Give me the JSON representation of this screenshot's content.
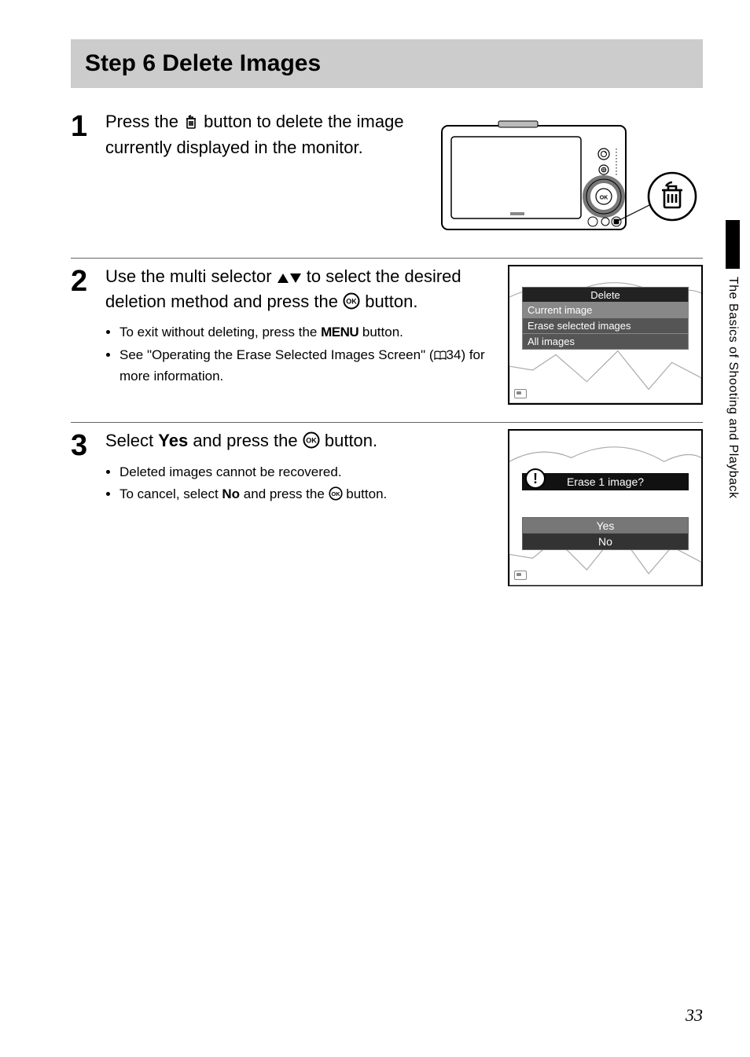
{
  "title": "Step 6 Delete Images",
  "sidebar_text": "The Basics of Shooting and Playback",
  "page_number": "33",
  "step1": {
    "number": "1",
    "text_before_icon": "Press the ",
    "text_after_icon": " button to delete the image currently displayed in the monitor."
  },
  "step2": {
    "number": "2",
    "main_a": "Use the multi selector ",
    "main_b": " to select the desired deletion method and press the ",
    "main_c": " button.",
    "bullet1_a": "To exit without deleting, press the ",
    "bullet1_menu": "MENU",
    "bullet1_b": " button.",
    "bullet2_a": "See \"Operating the Erase Selected Images Screen\" (",
    "bullet2_ref": "34",
    "bullet2_b": ") for more information.",
    "menu_title": "Delete",
    "menu_items": [
      "Current image",
      "Erase selected images",
      "All images"
    ]
  },
  "step3": {
    "number": "3",
    "main_a": "Select ",
    "main_yes": "Yes",
    "main_b": " and press the ",
    "main_c": " button.",
    "bullet1": "Deleted images cannot be recovered.",
    "bullet2_a": "To cancel, select ",
    "bullet2_no": "No",
    "bullet2_b": " and press the ",
    "bullet2_c": " button.",
    "prompt": "Erase 1 image?",
    "opt_yes": "Yes",
    "opt_no": "No"
  }
}
